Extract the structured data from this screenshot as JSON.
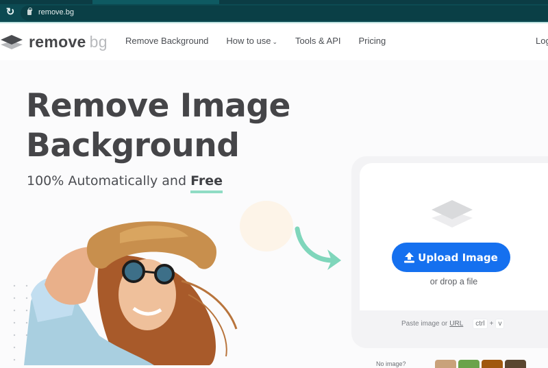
{
  "browser": {
    "url": "remove.bg",
    "reload_icon": "reload-icon",
    "lock_icon": "lock-icon"
  },
  "nav": {
    "logo_word": "remove",
    "logo_suffix": "bg",
    "links": [
      {
        "label": "Remove Background"
      },
      {
        "label": "How to use",
        "has_dropdown": true,
        "chevron": "⌄"
      },
      {
        "label": "Tools & API"
      },
      {
        "label": "Pricing"
      }
    ],
    "login_label": "Log"
  },
  "hero": {
    "title_line1": "Remove Image",
    "title_line2": "Background",
    "subtitle_prefix": "100% Automatically and ",
    "subtitle_highlight": "Free"
  },
  "upload": {
    "button_label": "Upload Image",
    "drop_text": "or drop a file",
    "paste_prefix": "Paste image or",
    "paste_link": "URL",
    "shortcut_key1": "ctrl",
    "shortcut_plus": "+",
    "shortcut_key2": "v"
  },
  "samples": {
    "label": "No image?",
    "thumbnails": [
      {
        "color": "#c9a27a"
      },
      {
        "color": "#6aa34a"
      },
      {
        "color": "#a0580f"
      },
      {
        "color": "#5a4630"
      }
    ]
  },
  "colors": {
    "accent_blue": "#1570ef",
    "accent_green": "#8fdcc4",
    "chrome_teal": "#0c4a52"
  }
}
